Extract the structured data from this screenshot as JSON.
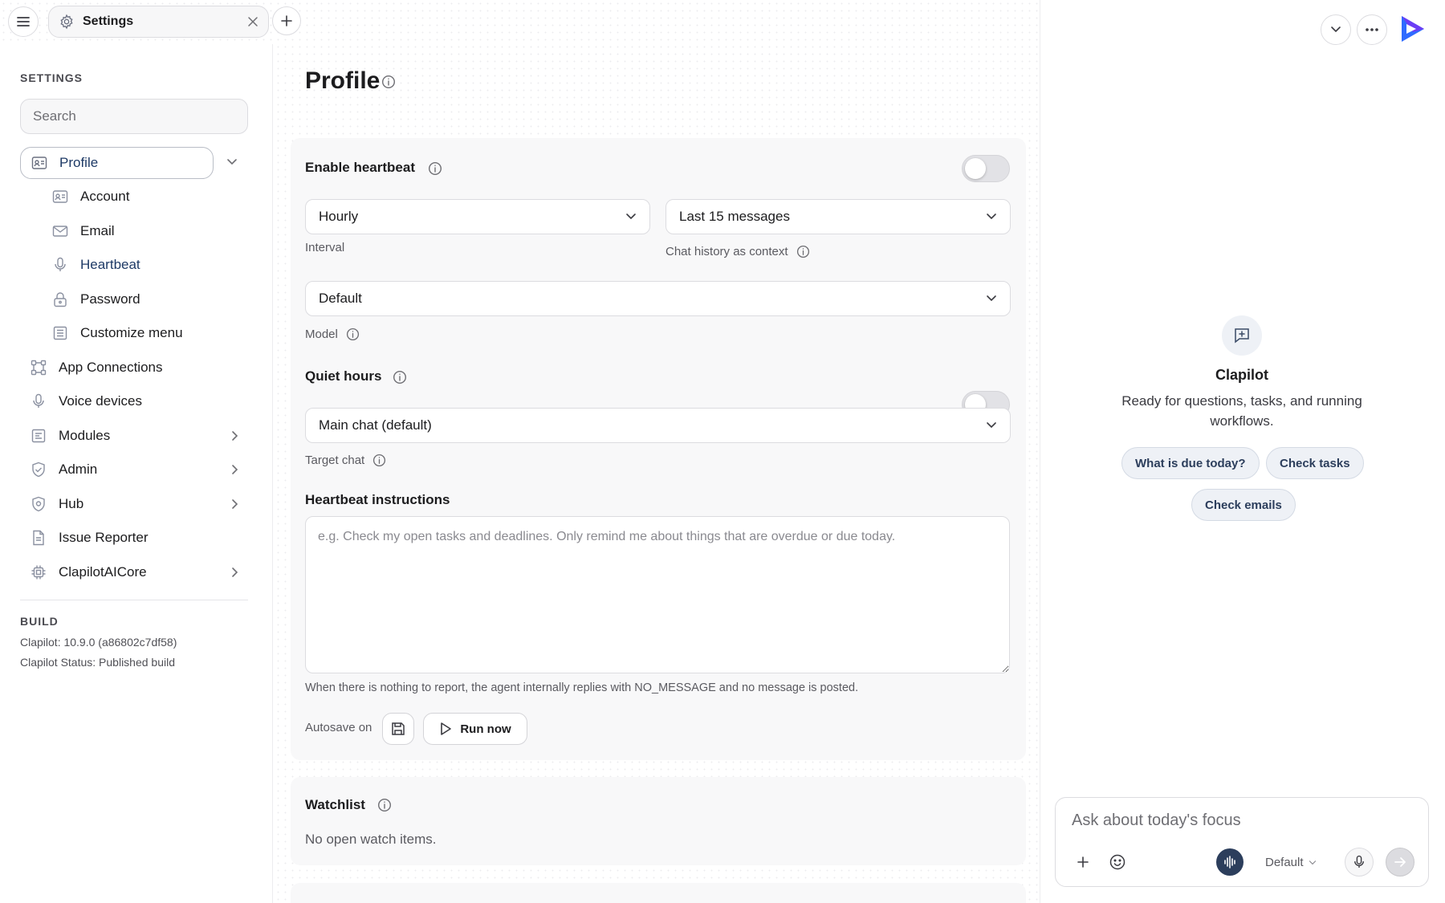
{
  "tab": {
    "label": "Settings"
  },
  "sidebar": {
    "section_title": "SETTINGS",
    "search_placeholder": "Search",
    "profile": "Profile",
    "sub_items": [
      "Account",
      "Email",
      "Heartbeat",
      "Password",
      "Customize menu"
    ],
    "items": [
      "App Connections",
      "Voice devices",
      "Modules",
      "Admin",
      "Hub",
      "Issue Reporter",
      "ClapilotAICore"
    ],
    "build_title": "BUILD",
    "build_version": "Clapilot: 10.9.0 (a86802c7df58)",
    "build_status": "Clapilot Status: Published build"
  },
  "main": {
    "title": "Profile",
    "enable_heartbeat": "Enable heartbeat",
    "interval_value": "Hourly",
    "interval_label": "Interval",
    "history_value": "Last 15 messages",
    "history_label": "Chat history as context",
    "model_value": "Default",
    "model_label": "Model",
    "quiet_hours": "Quiet hours",
    "target_value": "Main chat (default)",
    "target_label": "Target chat",
    "instructions_title": "Heartbeat instructions",
    "instructions_placeholder": "e.g. Check my open tasks and deadlines. Only remind me about things that are overdue or due today.",
    "hint": "When there is nothing to report, the agent internally replies with NO_MESSAGE and no message is posted.",
    "autosave": "Autosave on",
    "run_now": "Run now",
    "watchlist_title": "Watchlist",
    "watchlist_empty": "No open watch items."
  },
  "assistant": {
    "name": "Clapilot",
    "tagline": "Ready for questions, tasks, and running workflows.",
    "chips": [
      "What is due today?",
      "Check tasks",
      "Check emails"
    ],
    "input_placeholder": "Ask about today's focus",
    "model_select": "Default"
  },
  "colors": {
    "accent": "#1e3a66",
    "brand_purple": "#6b3df5",
    "brand_blue": "#2f6bff"
  }
}
